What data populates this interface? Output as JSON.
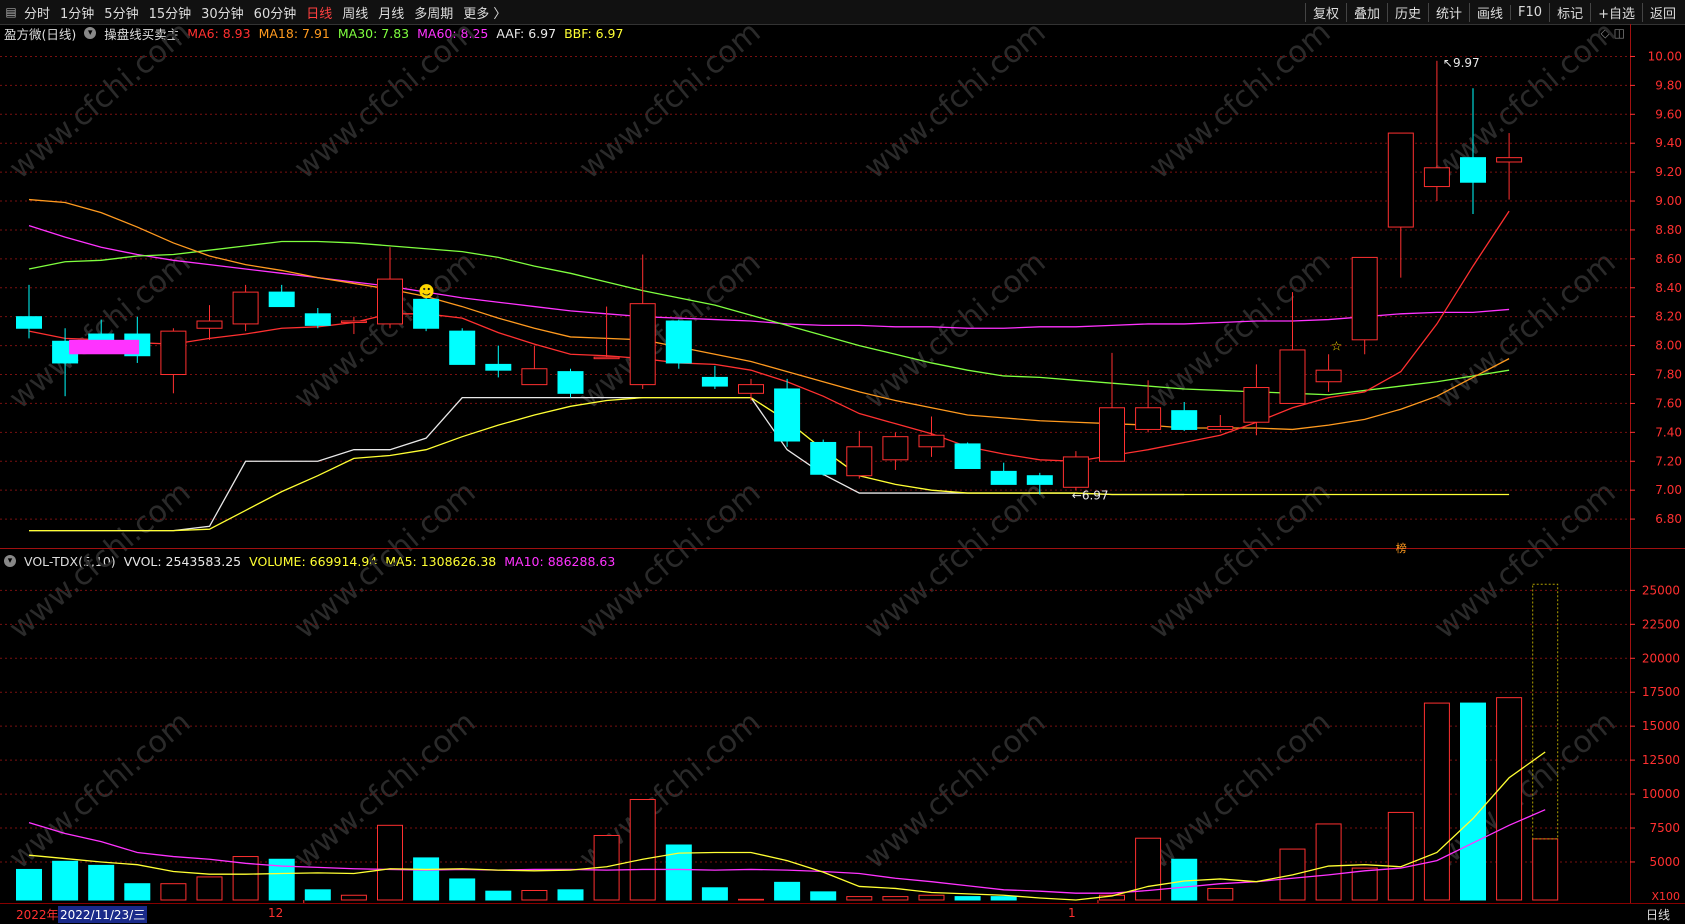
{
  "toolbar": {
    "tabs": [
      "分时",
      "1分钟",
      "5分钟",
      "15分钟",
      "30分钟",
      "60分钟",
      "日线",
      "周线",
      "月线",
      "多周期",
      "更多 〉"
    ],
    "active_tab": "日线",
    "right_buttons": [
      "复权",
      "叠加",
      "历史",
      "统计",
      "画线",
      "F10",
      "标记",
      "+自选",
      "返回"
    ]
  },
  "main_legend": {
    "stock": "盈方微(日线)",
    "indicator": "操盘线买卖主",
    "items": [
      {
        "text": "MA6: 8.93",
        "color": "#ff3030"
      },
      {
        "text": "MA18: 7.91",
        "color": "#ff9a1f"
      },
      {
        "text": "MA30: 7.83",
        "color": "#7fff3f"
      },
      {
        "text": "MA60: 8.25",
        "color": "#ff33ff"
      },
      {
        "text": "AAF: 6.97",
        "color": "#e8e8e8"
      },
      {
        "text": "BBF: 6.97",
        "color": "#ffff33"
      }
    ]
  },
  "vol_legend": {
    "name": "VOL-TDX(5,10)",
    "items": [
      {
        "text": "VVOL: 2543583.25",
        "color": "#e8e8e8"
      },
      {
        "text": "VOLUME: 669914.94",
        "color": "#ffff33"
      },
      {
        "text": "MA5: 1308626.38",
        "color": "#ffff33"
      },
      {
        "text": "MA10: 886288.63",
        "color": "#ff33ff"
      }
    ]
  },
  "bottom": {
    "year": "2022年",
    "date": "2022/11/23/三",
    "month1": "12",
    "month2": "1",
    "period": "日线",
    "multiplier": "X100"
  },
  "annotations": {
    "high": "9.97",
    "low": "6.97",
    "marker": "榜"
  },
  "colors": {
    "up": "#ff3030",
    "down": "#00ffff",
    "grid": "#7a1010",
    "axis": "#ff3030"
  },
  "chart_data": [
    {
      "type": "candlestick",
      "ylim": [
        6.6,
        10.1
      ],
      "yticks": [
        6.8,
        7.0,
        7.2,
        7.4,
        7.6,
        7.8,
        8.0,
        8.2,
        8.4,
        8.6,
        8.8,
        9.0,
        9.2,
        9.4,
        9.6,
        9.8,
        10.0
      ],
      "candles": [
        {
          "o": 8.2,
          "h": 8.42,
          "l": 8.05,
          "c": 8.12
        },
        {
          "o": 8.03,
          "h": 8.12,
          "l": 7.65,
          "c": 7.88
        },
        {
          "o": 8.08,
          "h": 8.18,
          "l": 7.96,
          "c": 7.98
        },
        {
          "o": 8.08,
          "h": 8.2,
          "l": 7.88,
          "c": 7.93
        },
        {
          "o": 7.8,
          "h": 8.12,
          "l": 7.67,
          "c": 8.1
        },
        {
          "o": 8.12,
          "h": 8.28,
          "l": 8.04,
          "c": 8.17
        },
        {
          "o": 8.15,
          "h": 8.42,
          "l": 8.1,
          "c": 8.37
        },
        {
          "o": 8.37,
          "h": 8.42,
          "l": 8.28,
          "c": 8.27
        },
        {
          "o": 8.22,
          "h": 8.26,
          "l": 8.12,
          "c": 8.14
        },
        {
          "o": 8.16,
          "h": 8.2,
          "l": 8.08,
          "c": 8.17
        },
        {
          "o": 8.15,
          "h": 8.68,
          "l": 8.12,
          "c": 8.46
        },
        {
          "o": 8.32,
          "h": 8.35,
          "l": 8.1,
          "c": 8.12
        },
        {
          "o": 8.1,
          "h": 8.12,
          "l": 7.88,
          "c": 7.87
        },
        {
          "o": 7.87,
          "h": 8.0,
          "l": 7.78,
          "c": 7.83
        },
        {
          "o": 7.73,
          "h": 8.0,
          "l": 7.73,
          "c": 7.84
        },
        {
          "o": 7.82,
          "h": 7.84,
          "l": 7.64,
          "c": 7.67
        },
        {
          "o": 7.92,
          "h": 8.27,
          "l": 7.91,
          "c": 7.92
        },
        {
          "o": 7.73,
          "h": 8.63,
          "l": 7.7,
          "c": 8.29
        },
        {
          "o": 8.17,
          "h": 8.18,
          "l": 7.84,
          "c": 7.88
        },
        {
          "o": 7.78,
          "h": 7.86,
          "l": 7.7,
          "c": 7.72
        },
        {
          "o": 7.67,
          "h": 7.77,
          "l": 7.62,
          "c": 7.73
        },
        {
          "o": 7.7,
          "h": 7.77,
          "l": 7.3,
          "c": 7.34
        },
        {
          "o": 7.33,
          "h": 7.35,
          "l": 7.1,
          "c": 7.11
        },
        {
          "o": 7.1,
          "h": 7.41,
          "l": 7.08,
          "c": 7.3
        },
        {
          "o": 7.21,
          "h": 7.4,
          "l": 7.14,
          "c": 7.37
        },
        {
          "o": 7.3,
          "h": 7.51,
          "l": 7.23,
          "c": 7.38
        },
        {
          "o": 7.32,
          "h": 7.33,
          "l": 7.15,
          "c": 7.15
        },
        {
          "o": 7.13,
          "h": 7.19,
          "l": 7.04,
          "c": 7.04
        },
        {
          "o": 7.1,
          "h": 7.12,
          "l": 6.97,
          "c": 7.04
        },
        {
          "o": 7.02,
          "h": 7.27,
          "l": 7.0,
          "c": 7.23
        },
        {
          "o": 7.2,
          "h": 7.95,
          "l": 7.2,
          "c": 7.57
        },
        {
          "o": 7.42,
          "h": 7.76,
          "l": 7.4,
          "c": 7.57
        },
        {
          "o": 7.55,
          "h": 7.61,
          "l": 7.41,
          "c": 7.42
        },
        {
          "o": 7.42,
          "h": 7.52,
          "l": 7.4,
          "c": 7.44
        },
        {
          "o": 7.47,
          "h": 7.87,
          "l": 7.38,
          "c": 7.71
        },
        {
          "o": 7.6,
          "h": 8.37,
          "l": 7.6,
          "c": 7.97
        },
        {
          "o": 7.75,
          "h": 7.94,
          "l": 7.68,
          "c": 7.83
        },
        {
          "o": 8.04,
          "h": 8.61,
          "l": 7.94,
          "c": 8.61
        },
        {
          "o": 8.82,
          "h": 9.47,
          "l": 8.47,
          "c": 9.47
        },
        {
          "o": 9.1,
          "h": 9.97,
          "l": 9.0,
          "c": 9.23
        },
        {
          "o": 9.3,
          "h": 9.78,
          "l": 8.91,
          "c": 9.13
        },
        {
          "o": 9.27,
          "h": 9.47,
          "l": 9.01,
          "c": 9.3
        }
      ],
      "ma6": [
        8.1,
        8.05,
        8.04,
        8.02,
        8.01,
        8.05,
        8.08,
        8.12,
        8.13,
        8.16,
        8.22,
        8.22,
        8.19,
        8.09,
        8.01,
        7.94,
        7.93,
        7.91,
        7.88,
        7.87,
        7.83,
        7.75,
        7.65,
        7.53,
        7.46,
        7.39,
        7.3,
        7.25,
        7.21,
        7.2,
        7.24,
        7.28,
        7.33,
        7.38,
        7.47,
        7.57,
        7.64,
        7.68,
        7.82,
        8.15,
        8.55,
        8.93
      ],
      "ma18": [
        9.01,
        8.99,
        8.92,
        8.82,
        8.71,
        8.62,
        8.56,
        8.52,
        8.47,
        8.43,
        8.39,
        8.34,
        8.27,
        8.19,
        8.12,
        8.06,
        8.05,
        8.04,
        7.99,
        7.94,
        7.89,
        7.82,
        7.75,
        7.68,
        7.62,
        7.57,
        7.52,
        7.5,
        7.48,
        7.47,
        7.46,
        7.45,
        7.43,
        7.43,
        7.43,
        7.42,
        7.45,
        7.49,
        7.56,
        7.65,
        7.78,
        7.91
      ],
      "ma30": [
        8.53,
        8.58,
        8.59,
        8.62,
        8.63,
        8.66,
        8.69,
        8.72,
        8.72,
        8.71,
        8.69,
        8.67,
        8.65,
        8.61,
        8.55,
        8.5,
        8.44,
        8.38,
        8.33,
        8.28,
        8.21,
        8.14,
        8.07,
        8.0,
        7.94,
        7.88,
        7.83,
        7.79,
        7.78,
        7.76,
        7.74,
        7.72,
        7.7,
        7.69,
        7.68,
        7.67,
        7.66,
        7.69,
        7.72,
        7.75,
        7.79,
        7.83
      ],
      "ma60": [
        8.83,
        8.75,
        8.68,
        8.63,
        8.59,
        8.56,
        8.53,
        8.5,
        8.47,
        8.44,
        8.41,
        8.37,
        8.33,
        8.3,
        8.27,
        8.24,
        8.22,
        8.2,
        8.19,
        8.18,
        8.17,
        8.15,
        8.14,
        8.14,
        8.13,
        8.13,
        8.12,
        8.12,
        8.13,
        8.13,
        8.14,
        8.15,
        8.15,
        8.16,
        8.17,
        8.17,
        8.18,
        8.2,
        8.22,
        8.23,
        8.23,
        8.25
      ],
      "aaf": [
        6.72,
        6.72,
        6.72,
        6.72,
        6.72,
        6.75,
        7.2,
        7.2,
        7.2,
        7.28,
        7.28,
        7.36,
        7.64,
        7.64,
        7.64,
        7.64,
        7.64,
        7.64,
        7.64,
        7.64,
        7.64,
        7.28,
        7.11,
        6.98,
        6.98,
        6.98,
        6.98,
        6.98,
        6.98,
        6.98,
        6.97,
        6.97,
        6.97,
        null,
        null,
        null,
        null,
        null,
        null,
        null,
        null,
        null
      ],
      "bbf": [
        6.72,
        6.72,
        6.72,
        6.72,
        6.72,
        6.73,
        6.86,
        6.99,
        7.1,
        7.22,
        7.24,
        7.28,
        7.37,
        7.45,
        7.52,
        7.58,
        7.62,
        7.64,
        7.64,
        7.64,
        7.64,
        7.48,
        7.28,
        7.1,
        7.04,
        7.0,
        6.98,
        6.98,
        6.98,
        6.98,
        6.97,
        6.97,
        6.97,
        6.97,
        6.97,
        6.97,
        6.97,
        6.97,
        6.97,
        6.97,
        6.97,
        6.97
      ]
    },
    {
      "type": "bar",
      "ylim": [
        2200,
        26500
      ],
      "yticks": [
        5000,
        7500,
        10000,
        12500,
        15000,
        17500,
        20000,
        22500,
        25000
      ],
      "volume": [
        4450,
        5050,
        4750,
        3400,
        3400,
        3900,
        5400,
        5200,
        2950,
        2550,
        7700,
        5300,
        3750,
        2850,
        2900,
        2950,
        6950,
        9600,
        6250,
        3100,
        2250,
        3500,
        2800,
        2450,
        2450,
        2550,
        2450,
        2450,
        1850,
        1450,
        2550,
        6750,
        5200,
        3050,
        1800,
        5950,
        7800,
        4550,
        8650,
        16700,
        16700,
        17100,
        6700
      ],
      "current_total": 25450,
      "ma5": [
        5500,
        5250,
        5000,
        4800,
        4300,
        4100,
        4100,
        4150,
        4200,
        4150,
        4500,
        4450,
        4500,
        4400,
        4350,
        4400,
        4650,
        5200,
        5650,
        5700,
        5700,
        5100,
        4250,
        3200,
        3050,
        2750,
        2650,
        2550,
        2350,
        2200,
        2500,
        3200,
        3600,
        3750,
        3550,
        4050,
        4700,
        4800,
        4650,
        5700,
        8200,
        11200,
        13100
      ],
      "ma10": [
        7900,
        7100,
        6500,
        5700,
        5400,
        5200,
        4900,
        4700,
        4600,
        4500,
        4450,
        4400,
        4450,
        4400,
        4450,
        4450,
        4400,
        4450,
        4450,
        4400,
        4450,
        4400,
        4300,
        4150,
        3800,
        3550,
        3250,
        2950,
        2850,
        2700,
        2700,
        2900,
        3150,
        3400,
        3550,
        3800,
        4050,
        4350,
        4550,
        5100,
        6400,
        7700,
        8850
      ]
    }
  ]
}
